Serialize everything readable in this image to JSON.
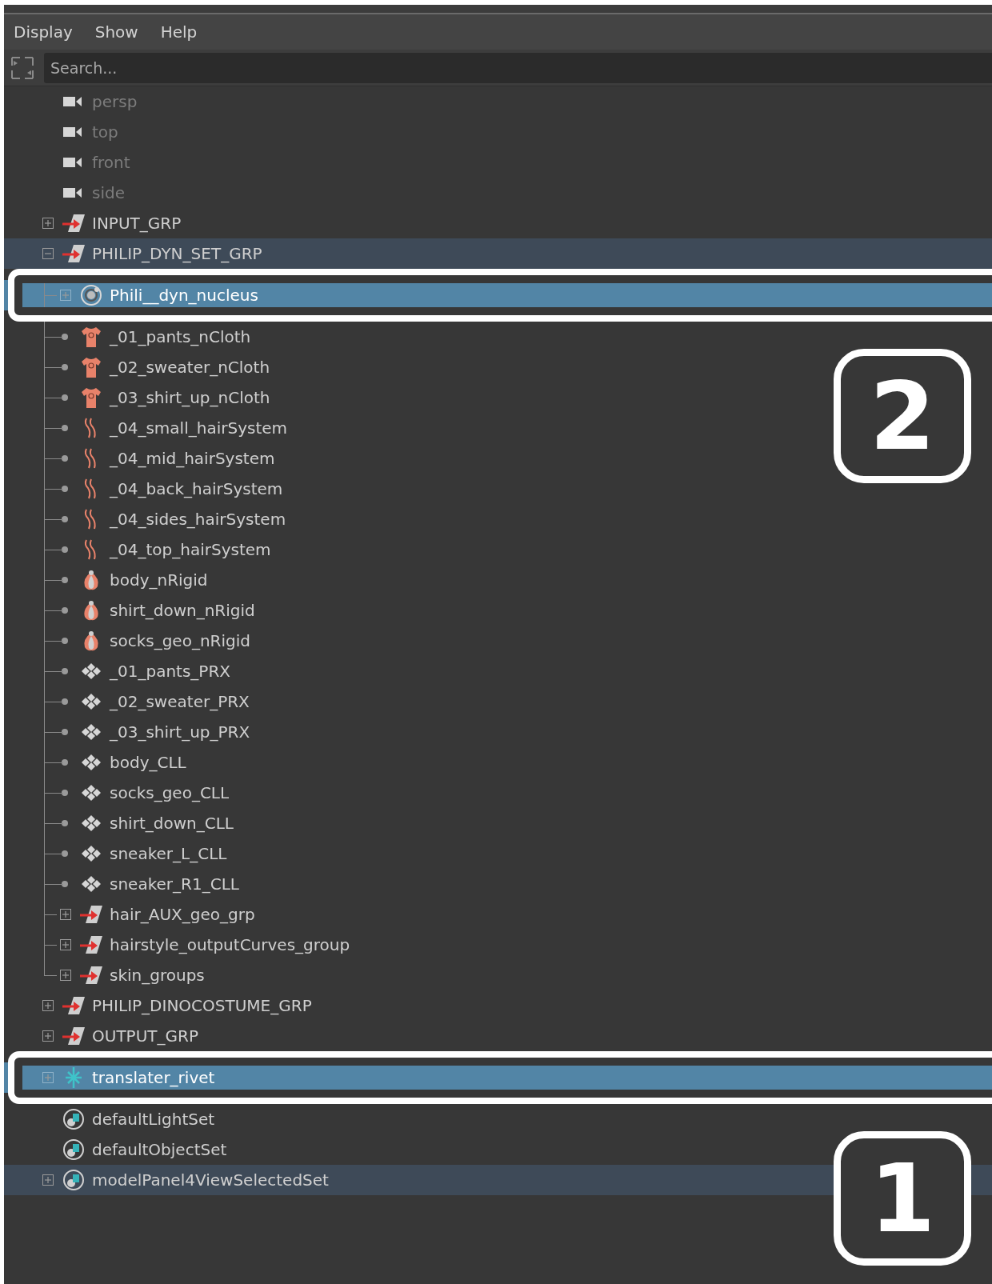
{
  "menu": [
    {
      "label": "Display"
    },
    {
      "label": "Show"
    },
    {
      "label": "Help"
    }
  ],
  "search": {
    "placeholder": "Search..."
  },
  "outliner": [
    {
      "name": "persp",
      "kind": "camera",
      "selected": false,
      "highlighted": false,
      "hidden": true
    },
    {
      "name": "top",
      "kind": "camera",
      "selected": false,
      "highlighted": false,
      "hidden": true
    },
    {
      "name": "front",
      "kind": "camera",
      "selected": false,
      "highlighted": false,
      "hidden": true
    },
    {
      "name": "side",
      "kind": "camera",
      "selected": false,
      "highlighted": false,
      "hidden": true
    },
    {
      "name": "INPUT_GRP",
      "kind": "group",
      "selected": false,
      "highlighted": false,
      "hidden": false,
      "expanded": false
    },
    {
      "name": "PHILIP_DYN_SET_GRP",
      "kind": "group",
      "selected": false,
      "highlighted": true,
      "hidden": false,
      "expanded": true,
      "children": [
        {
          "name": "Phili__dyn_nucleus",
          "kind": "nucleus",
          "selected": true,
          "highlighted": false,
          "hidden": false,
          "expanded": false,
          "callout": "2"
        },
        {
          "name": "_01_pants_nCloth",
          "kind": "ncloth",
          "selected": false,
          "highlighted": false,
          "hidden": false
        },
        {
          "name": "_02_sweater_nCloth",
          "kind": "ncloth",
          "selected": false,
          "highlighted": false,
          "hidden": false
        },
        {
          "name": "_03_shirt_up_nCloth",
          "kind": "ncloth",
          "selected": false,
          "highlighted": false,
          "hidden": false
        },
        {
          "name": "_04_small_hairSystem",
          "kind": "hair",
          "selected": false,
          "highlighted": false,
          "hidden": false
        },
        {
          "name": "_04_mid_hairSystem",
          "kind": "hair",
          "selected": false,
          "highlighted": false,
          "hidden": false
        },
        {
          "name": "_04_back_hairSystem",
          "kind": "hair",
          "selected": false,
          "highlighted": false,
          "hidden": false
        },
        {
          "name": "_04_sides_hairSystem",
          "kind": "hair",
          "selected": false,
          "highlighted": false,
          "hidden": false
        },
        {
          "name": "_04_top_hairSystem",
          "kind": "hair",
          "selected": false,
          "highlighted": false,
          "hidden": false
        },
        {
          "name": "body_nRigid",
          "kind": "nrigid",
          "selected": false,
          "highlighted": false,
          "hidden": false
        },
        {
          "name": "shirt_down_nRigid",
          "kind": "nrigid",
          "selected": false,
          "highlighted": false,
          "hidden": false
        },
        {
          "name": "socks_geo_nRigid",
          "kind": "nrigid",
          "selected": false,
          "highlighted": false,
          "hidden": false
        },
        {
          "name": "_01_pants_PRX",
          "kind": "mesh",
          "selected": false,
          "highlighted": false,
          "hidden": false
        },
        {
          "name": "_02_sweater_PRX",
          "kind": "mesh",
          "selected": false,
          "highlighted": false,
          "hidden": false
        },
        {
          "name": "_03_shirt_up_PRX",
          "kind": "mesh",
          "selected": false,
          "highlighted": false,
          "hidden": false
        },
        {
          "name": "body_CLL",
          "kind": "mesh",
          "selected": false,
          "highlighted": false,
          "hidden": false
        },
        {
          "name": "socks_geo_CLL",
          "kind": "mesh",
          "selected": false,
          "highlighted": false,
          "hidden": false
        },
        {
          "name": "shirt_down_CLL",
          "kind": "mesh",
          "selected": false,
          "highlighted": false,
          "hidden": false
        },
        {
          "name": "sneaker_L_CLL",
          "kind": "mesh",
          "selected": false,
          "highlighted": false,
          "hidden": false
        },
        {
          "name": "sneaker_R1_CLL",
          "kind": "mesh",
          "selected": false,
          "highlighted": false,
          "hidden": false
        },
        {
          "name": "hair_AUX_geo_grp",
          "kind": "group",
          "selected": false,
          "highlighted": false,
          "hidden": false,
          "expanded": false
        },
        {
          "name": "hairstyle_outputCurves_group",
          "kind": "group",
          "selected": false,
          "highlighted": false,
          "hidden": false,
          "expanded": false
        },
        {
          "name": "skin_groups",
          "kind": "group",
          "selected": false,
          "highlighted": false,
          "hidden": false,
          "expanded": false
        }
      ]
    },
    {
      "name": "PHILIP_DINOCOSTUME_GRP",
      "kind": "group",
      "selected": false,
      "highlighted": false,
      "hidden": false,
      "expanded": false
    },
    {
      "name": "OUTPUT_GRP",
      "kind": "group",
      "selected": false,
      "highlighted": false,
      "hidden": false,
      "expanded": false
    },
    {
      "name": "translater_rivet",
      "kind": "rivet",
      "selected": true,
      "highlighted": false,
      "hidden": false,
      "expanded": false,
      "callout": "1"
    },
    {
      "name": "defaultLightSet",
      "kind": "set",
      "selected": false,
      "highlighted": false,
      "hidden": false
    },
    {
      "name": "defaultObjectSet",
      "kind": "set",
      "selected": false,
      "highlighted": false,
      "hidden": false
    },
    {
      "name": "modelPanel4ViewSelectedSet",
      "kind": "set",
      "selected": false,
      "highlighted": true,
      "hidden": false,
      "expanded": false
    }
  ]
}
